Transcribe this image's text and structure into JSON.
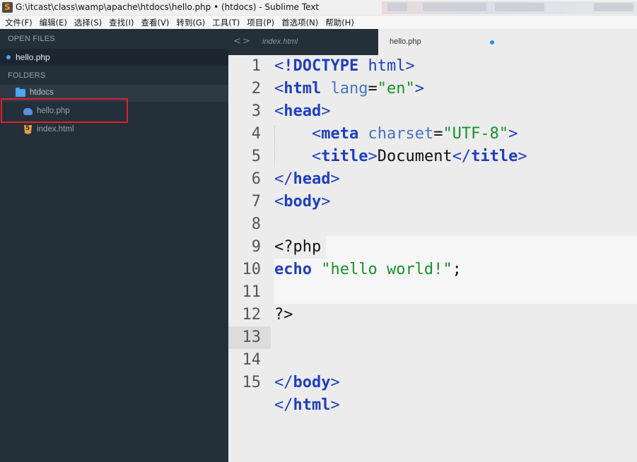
{
  "window": {
    "title": "G:\\itcast\\class\\wamp\\apache\\htdocs\\hello.php • (htdocs) - Sublime Text"
  },
  "menu": [
    "文件(F)",
    "编辑(E)",
    "选择(S)",
    "查找(I)",
    "查看(V)",
    "转到(G)",
    "工具(T)",
    "项目(P)",
    "首选项(N)",
    "帮助(H)"
  ],
  "sidebar": {
    "open_files_header": "OPEN FILES",
    "open_file": "hello.php",
    "folders_header": "FOLDERS",
    "folder": "htdocs",
    "files": [
      "hello.php",
      "index.html"
    ]
  },
  "tabs": {
    "nav_back": "<",
    "nav_forward": ">",
    "inactive": "index.html",
    "active": "hello.php"
  },
  "editor": {
    "line_numbers": [
      "1",
      "2",
      "3",
      "4",
      "5",
      "6",
      "7",
      "8",
      "9",
      "10",
      "11",
      "12",
      "13",
      "14",
      "15"
    ],
    "active_line": 13,
    "code": {
      "l1_lt": "<",
      "l1_doctype": "!DOCTYPE",
      "l1_html": " html",
      "l1_gt": ">",
      "l2_lt": "<",
      "l2_tag": "html",
      "l2_attr": " lang",
      "l2_eq": "=",
      "l2_val": "\"en\"",
      "l2_gt": ">",
      "l3_lt": "<",
      "l3_tag": "head",
      "l3_gt": ">",
      "l4_indent": "    ",
      "l4_lt": "<",
      "l4_tag": "meta",
      "l4_attr": " charset",
      "l4_eq": "=",
      "l4_val": "\"UTF-8\"",
      "l4_gt": ">",
      "l5_indent": "    ",
      "l5_lt": "<",
      "l5_tag": "title",
      "l5_gt": ">",
      "l5_text": "Document",
      "l5_lt2": "</",
      "l5_tag2": "title",
      "l5_gt2": ">",
      "l6_lt": "</",
      "l6_tag": "head",
      "l6_gt": ">",
      "l7_lt": "<",
      "l7_tag": "body",
      "l7_gt": ">",
      "l9_text": "<?php",
      "l10_kw": "echo",
      "l10_sp": " ",
      "l10_str": "\"hello world!\"",
      "l10_semi": ";",
      "l12_text": "?>",
      "l14_lt": "</",
      "l14_tag": "body",
      "l14_gt": ">",
      "l15_lt": "</",
      "l15_tag": "html",
      "l15_gt": ">"
    }
  },
  "colors": {
    "sidebar_bg": "#23303a",
    "editor_bg": "#ececec",
    "tag_blue": "#1f3fbf",
    "string_green": "#16922c",
    "highlight_red": "#e0202b"
  }
}
